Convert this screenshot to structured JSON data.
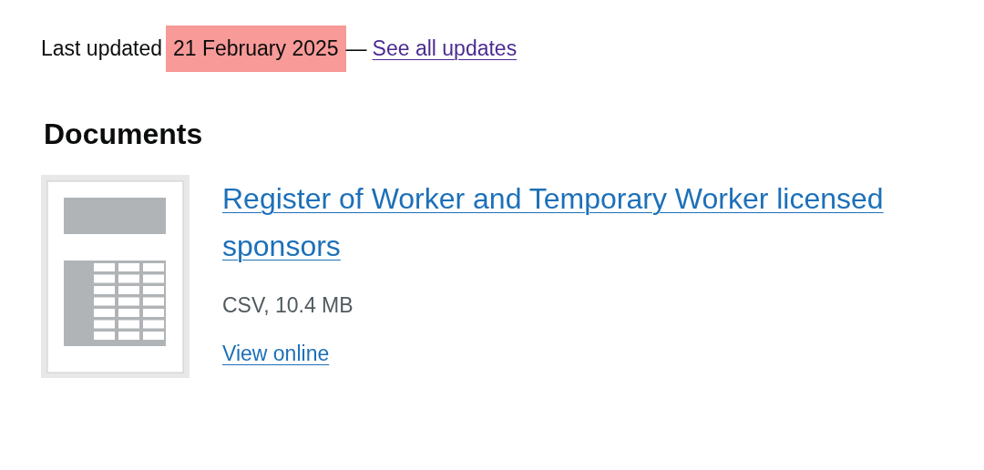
{
  "last_updated": {
    "label": "Last updated",
    "date": "21 February 2025",
    "date_highlighted": true,
    "separator": "—",
    "link": "See all updates"
  },
  "documents": {
    "heading": "Documents",
    "items": [
      {
        "title": "Register of Worker and Temporary Worker licensed sponsors",
        "meta": "CSV, 10.4 MB",
        "link": "View online"
      }
    ]
  }
}
